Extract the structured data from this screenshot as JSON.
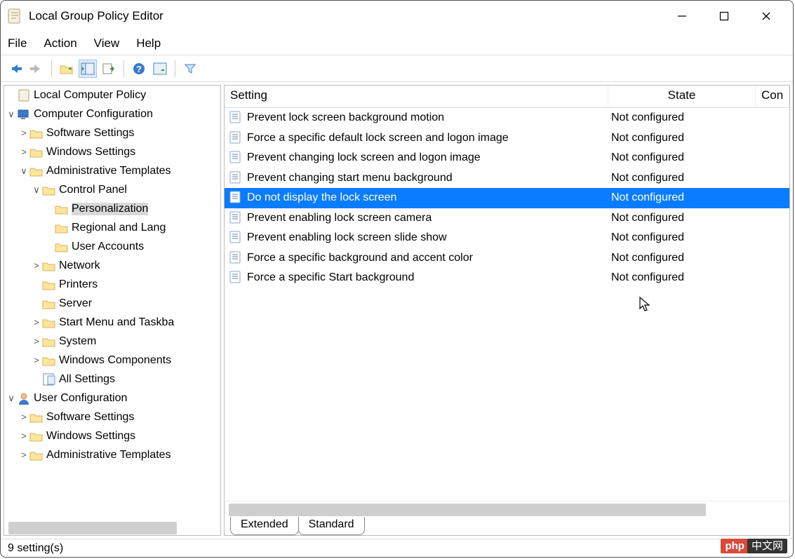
{
  "window": {
    "title": "Local Group Policy Editor"
  },
  "menubar": [
    "File",
    "Action",
    "View",
    "Help"
  ],
  "tree": {
    "root": "Local Computer Policy",
    "computer": "Computer Configuration",
    "cc": {
      "software": "Software Settings",
      "windows": "Windows Settings",
      "admin": "Administrative Templates",
      "cp": "Control Panel",
      "pers": "Personalization",
      "reg": "Regional and Lang",
      "ua": "User Accounts",
      "net": "Network",
      "prn": "Printers",
      "srv": "Server",
      "start": "Start Menu and Taskba",
      "sys": "System",
      "wcomp": "Windows Components",
      "all": "All Settings"
    },
    "user": "User Configuration",
    "uc": {
      "software": "Software Settings",
      "windows": "Windows Settings",
      "admin": "Administrative Templates"
    }
  },
  "columns": {
    "setting": "Setting",
    "state": "State",
    "con": "Con"
  },
  "settings": [
    {
      "name": "Prevent lock screen background motion",
      "state": "Not configured"
    },
    {
      "name": "Force a specific default lock screen and logon image",
      "state": "Not configured"
    },
    {
      "name": "Prevent changing lock screen and logon image",
      "state": "Not configured"
    },
    {
      "name": "Prevent changing start menu background",
      "state": "Not configured"
    },
    {
      "name": "Do not display the lock screen",
      "state": "Not configured",
      "selected": true
    },
    {
      "name": "Prevent enabling lock screen camera",
      "state": "Not configured"
    },
    {
      "name": "Prevent enabling lock screen slide show",
      "state": "Not configured"
    },
    {
      "name": "Force a specific background and accent color",
      "state": "Not configured"
    },
    {
      "name": "Force a specific Start background",
      "state": "Not configured"
    }
  ],
  "tabs": {
    "extended": "Extended",
    "standard": "Standard"
  },
  "status": "9 setting(s)",
  "logo": {
    "p": "php",
    "d": "中文网"
  }
}
